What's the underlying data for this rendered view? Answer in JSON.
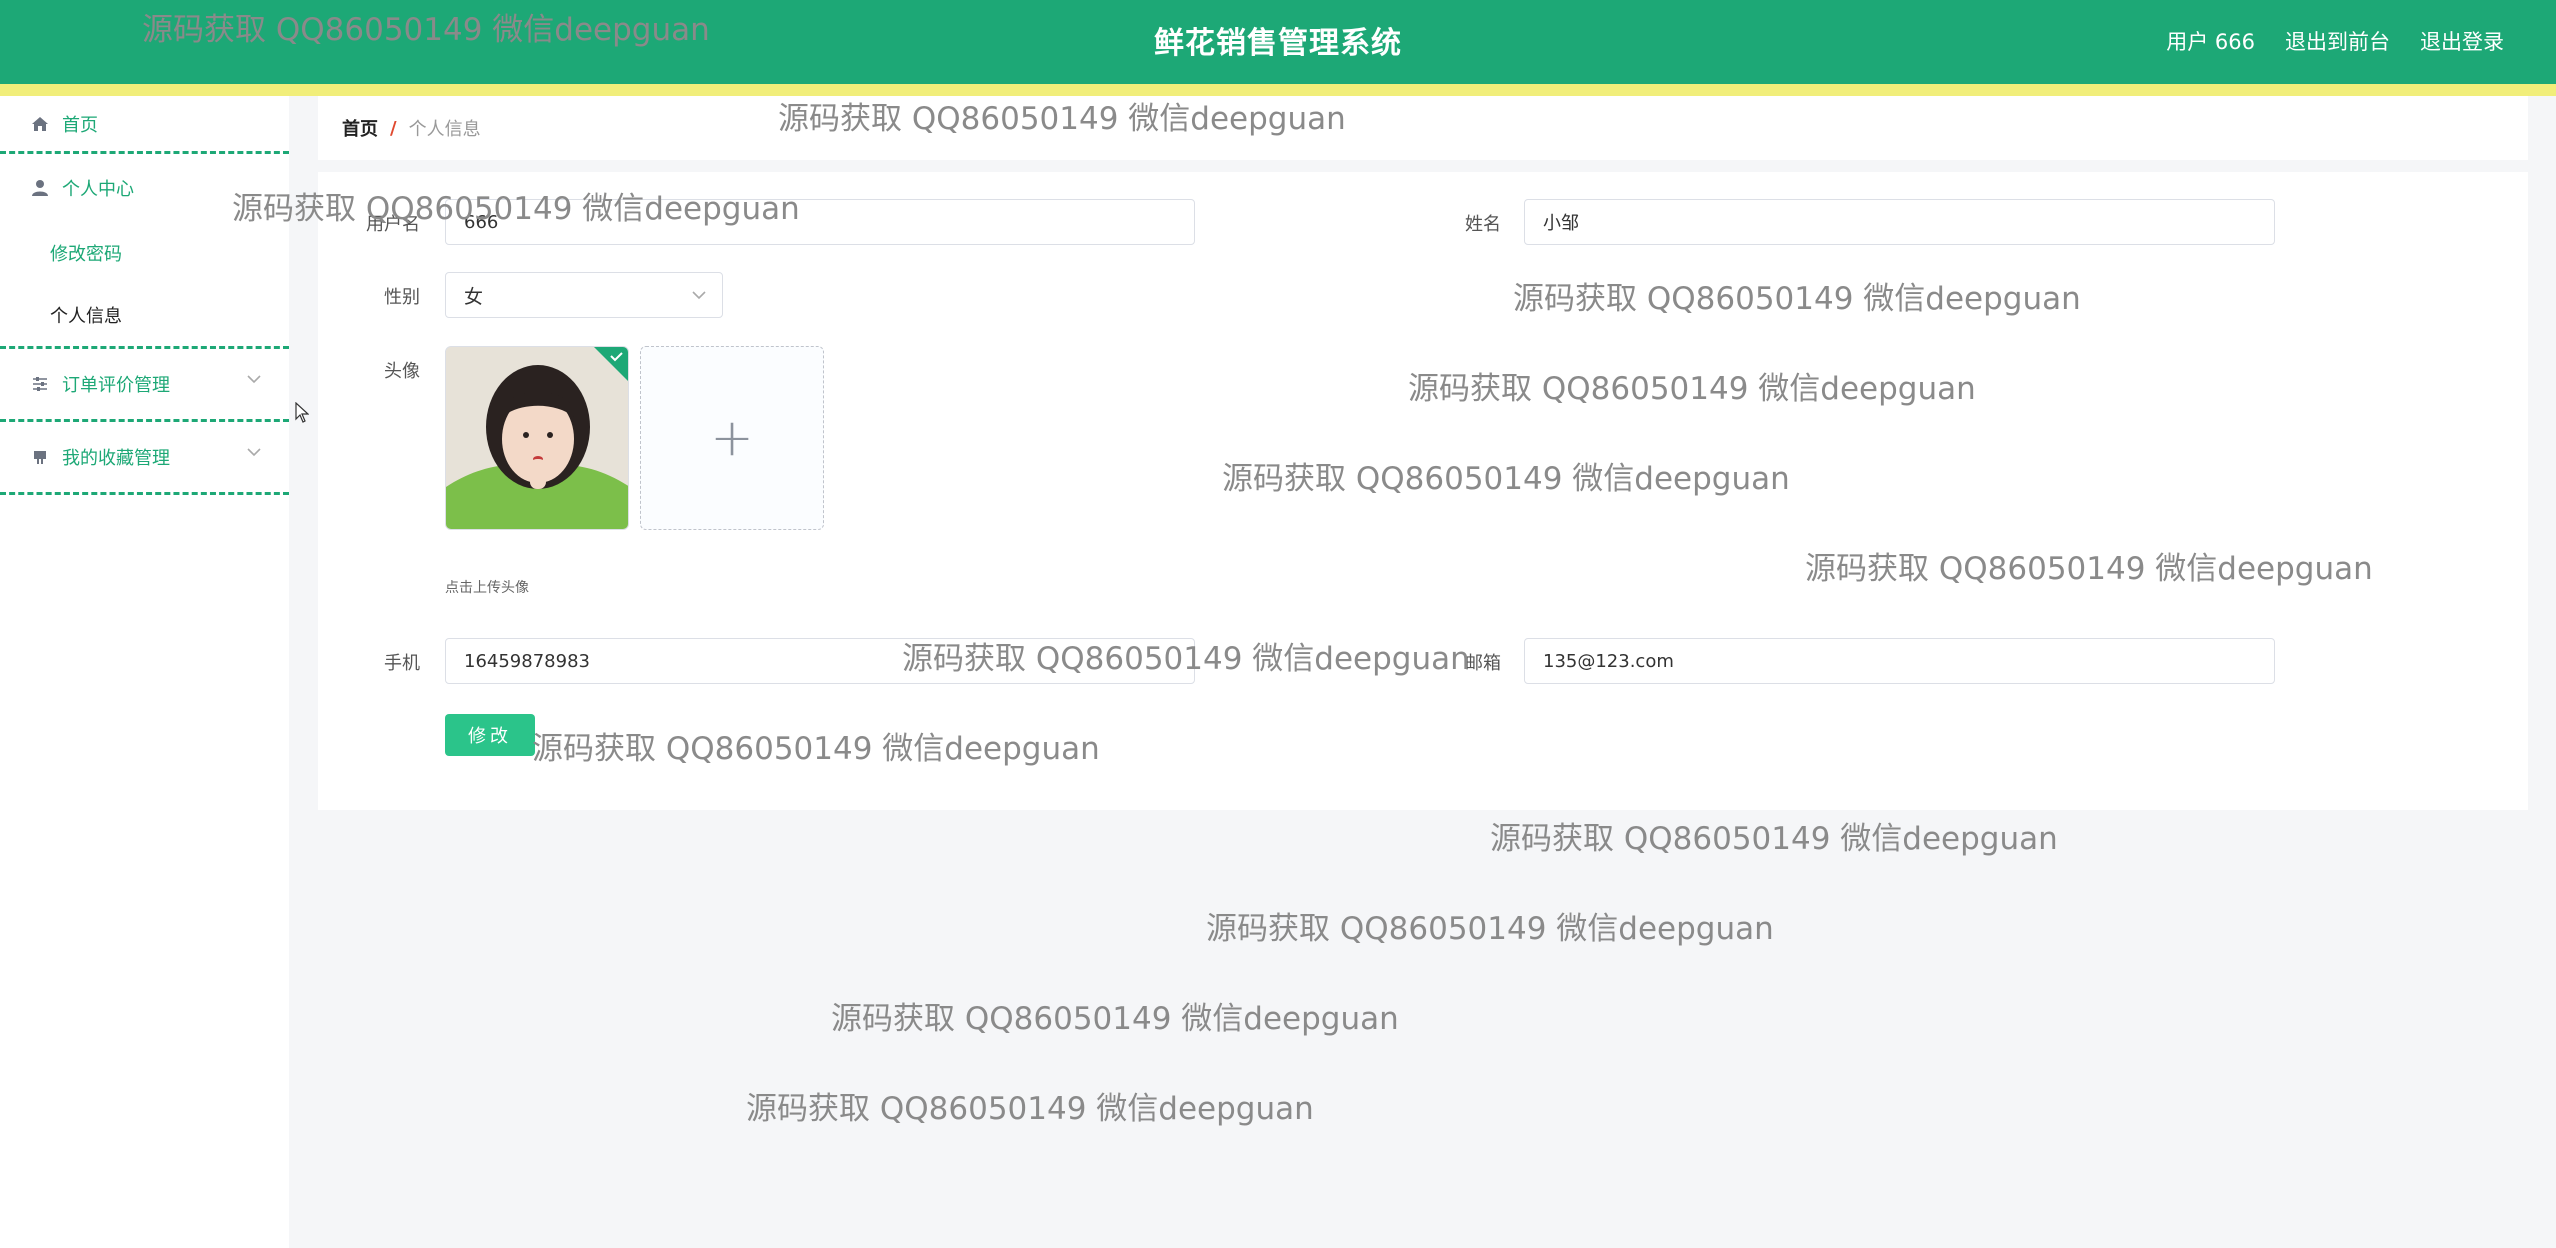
{
  "header": {
    "title": "鲜花销售管理系统",
    "user_label": "用户 666",
    "back_to_front": "退出到前台",
    "logout": "退出登录"
  },
  "sidebar": {
    "items": [
      {
        "label": "首页",
        "icon": "home-icon"
      },
      {
        "label": "个人中心",
        "icon": "user-icon"
      },
      {
        "label": "订单评价管理",
        "icon": "sliders-icon"
      },
      {
        "label": "我的收藏管理",
        "icon": "bookmark-icon"
      }
    ],
    "sub_items": [
      {
        "label": "修改密码"
      },
      {
        "label": "个人信息"
      }
    ]
  },
  "breadcrumb": {
    "home": "首页",
    "separator": "/",
    "current": "个人信息"
  },
  "form": {
    "username_label": "用户名",
    "username_value": "666",
    "name_label": "姓名",
    "name_value": "小邹",
    "gender_label": "性别",
    "gender_value": "女",
    "avatar_label": "头像",
    "upload_plus": "+",
    "upload_hint": "点击上传头像",
    "phone_label": "手机",
    "phone_value": "16459878983",
    "email_label": "邮箱",
    "email_value": "135@123.com",
    "submit_label": "修改"
  },
  "watermark": "源码获取 QQ86050149 微信deepguan",
  "colors": {
    "brand": "#1da876",
    "stripe": "#f1ee7a",
    "button": "#2bc48a"
  }
}
